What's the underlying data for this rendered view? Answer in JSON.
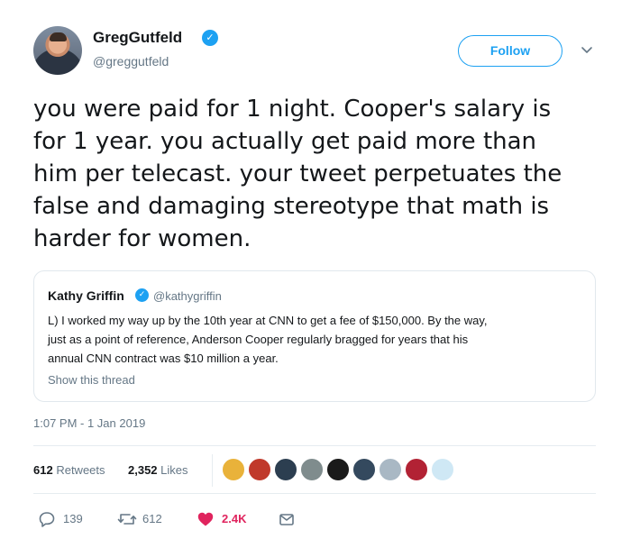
{
  "author": {
    "display_name": "GregGutfeld",
    "verified_icon": "verified-badge-icon",
    "handle": "@greggutfeld"
  },
  "follow_button": {
    "label": "Follow"
  },
  "menu": {
    "icon": "chevron-down-icon"
  },
  "tweet": {
    "text": "you were paid for 1 night. Cooper's salary is\nfor 1 year. you actually get paid more than\nhim per telecast. your tweet perpetuates the\nfalse and damaging stereotype that math is\nharder for women."
  },
  "quoted_tweet": {
    "display_name": "Kathy Griffin",
    "handle": "@kathygriffin",
    "text": "L) I worked my way up by the 10th year at CNN to get a fee of $150,000. By the way,\njust as a point of reference, Anderson Cooper regularly bragged for years that his\nannual CNN contract was $10 million a year.",
    "show_thread": "Show this thread"
  },
  "timestamp": "1:07 PM - 1 Jan 2019",
  "stats": {
    "retweets_count": "612",
    "retweets_label": "Retweets",
    "likes_count": "2,352",
    "likes_label": "Likes"
  },
  "liker_colors": [
    "#e9b23a",
    "#c0392b",
    "#2c3e50",
    "#7f8c8d",
    "#1a1a1a",
    "#34495e",
    "#a9b8c4",
    "#b22234",
    "#cfe8f5"
  ],
  "actions": {
    "reply_count": "139",
    "retweet_count": "612",
    "like_count": "2.4K",
    "colors": {
      "accent": "#1da1f2",
      "like": "#e0245e",
      "muted": "#657786"
    }
  }
}
